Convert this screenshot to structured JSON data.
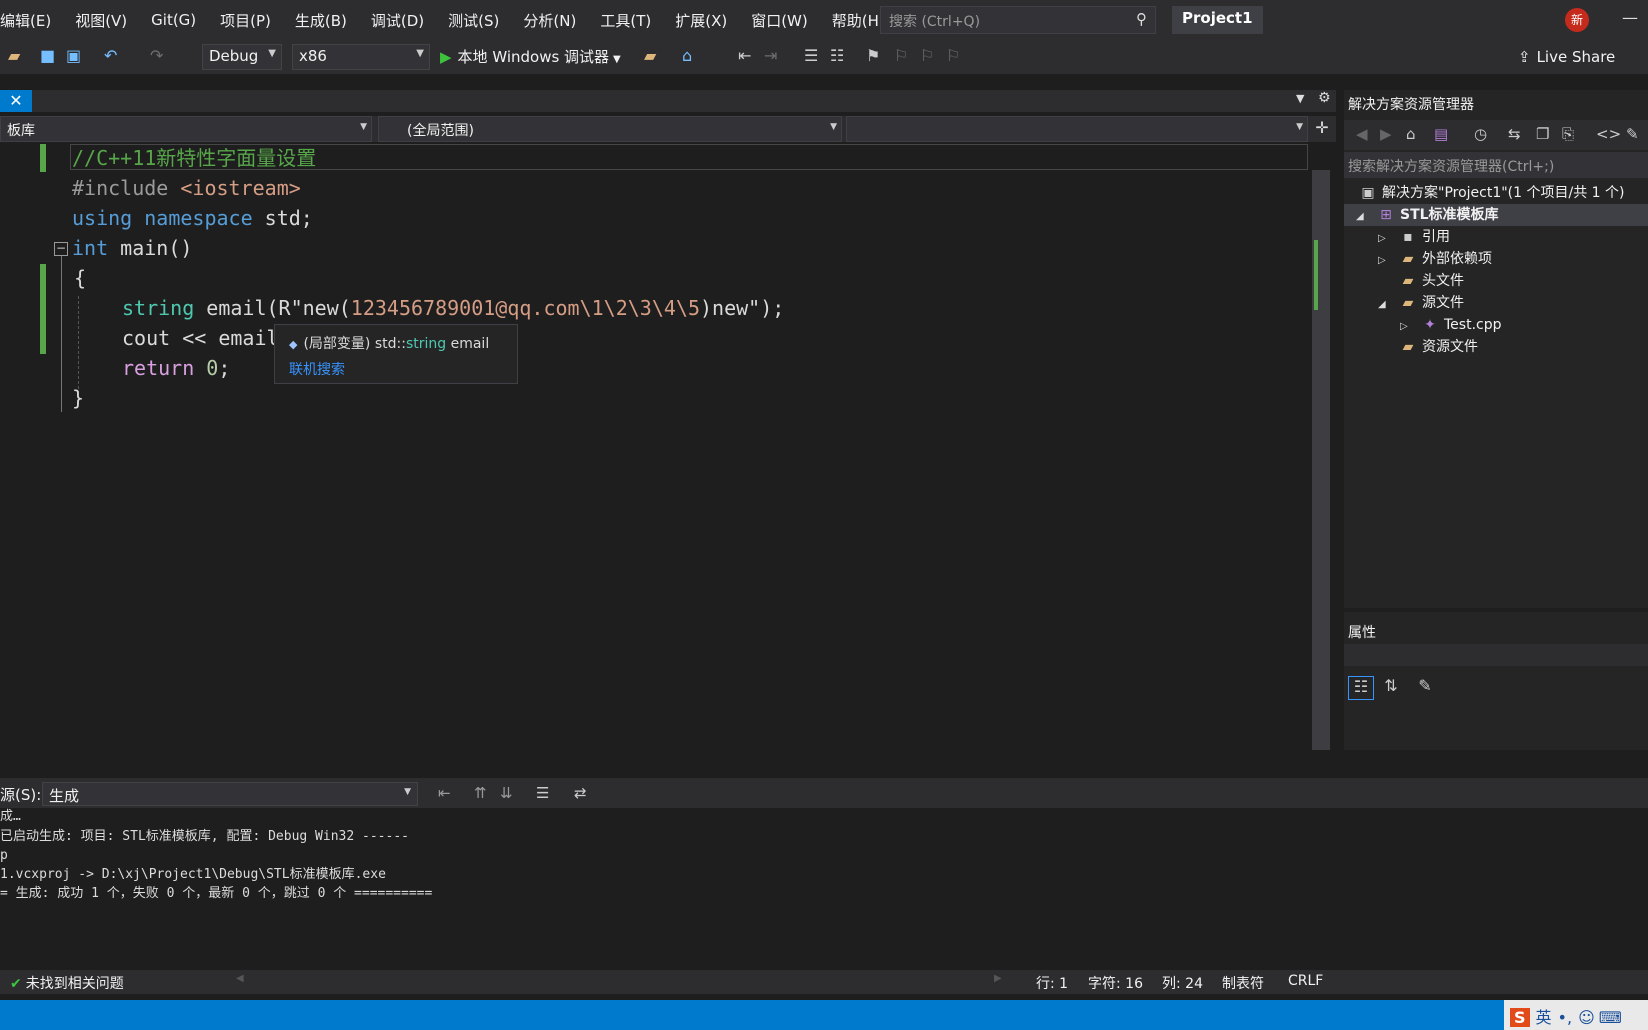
{
  "menu": [
    "编辑(E)",
    "视图(V)",
    "Git(G)",
    "项目(P)",
    "生成(B)",
    "调试(D)",
    "测试(S)",
    "分析(N)",
    "工具(T)",
    "扩展(X)",
    "窗口(W)",
    "帮助(H)"
  ],
  "search_placeholder": "搜索 (Ctrl+Q)",
  "project_name": "Project1",
  "news_badge": "新",
  "toolbar": {
    "config": "Debug",
    "platform": "x86",
    "run_label": "本地 Windows 调试器",
    "live_share": "Live Share"
  },
  "navbar": {
    "project_scope": "板库",
    "global_scope": "(全局范围)"
  },
  "code": {
    "line1": "//C++11新特性字面量设置",
    "line2_pre": "#include ",
    "line2_inc": "<iostream>",
    "line3_kw1": "using",
    "line3_kw2": "namespace",
    "line3_rest": " std;",
    "line4_kw": "int",
    "line4_rest": " main()",
    "line5": "{",
    "line6_type": "string",
    "line6_ident": " email(R\"new(",
    "line6_str": "123456789001@qq.com\\1\\2\\3\\4\\5",
    "line6_tail": ")new\");",
    "line7": "cout << email",
    "line8_kw": "return",
    "line8_num": "0",
    "line8_tail": ";",
    "line9": "}"
  },
  "tooltip": {
    "prefix": "(局部变量) std::",
    "type": "string",
    "suffix": " email",
    "link": "联机搜索"
  },
  "solution_explorer": {
    "title": "解决方案资源管理器",
    "search": "搜索解决方案资源管理器(Ctrl+;)",
    "items": [
      {
        "label": "解决方案\"Project1\"(1 个项目/共 1 个)"
      },
      {
        "label": "STL标准模板库"
      },
      {
        "label": "引用"
      },
      {
        "label": "外部依赖项"
      },
      {
        "label": "头文件"
      },
      {
        "label": "源文件"
      },
      {
        "label": "Test.cpp"
      },
      {
        "label": "资源文件"
      }
    ]
  },
  "properties_title": "属性",
  "output": {
    "label": "源(S):",
    "source": "生成",
    "lines": [
      "成…",
      "已启动生成: 项目: STL标准模板库, 配置: Debug Win32 ------",
      "p",
      "1.vcxproj -> D:\\xj\\Project1\\Debug\\STL标准模板库.exe",
      "= 生成: 成功 1 个，失败 0 个，最新 0 个，跳过 0 个 =========="
    ]
  },
  "errors": {
    "status": "未找到相关问题",
    "line": "行: 1",
    "char": "字符: 16",
    "col": "列: 24",
    "tabs": "制表符",
    "eol": "CRLF"
  },
  "ime": {
    "logo": "S",
    "lang": "英"
  },
  "colors": {
    "accent": "#007acc",
    "change_bar": "#57a64a"
  }
}
